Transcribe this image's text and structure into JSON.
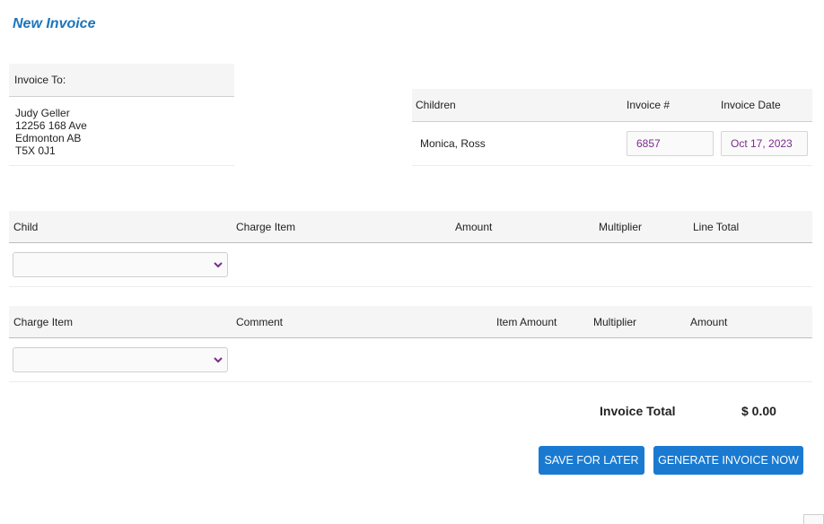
{
  "page": {
    "title": "New Invoice"
  },
  "invoice_to": {
    "label": "Invoice To:",
    "name": "Judy Geller",
    "street": "12256 168 Ave",
    "city": "Edmonton AB",
    "postal": "T5X 0J1"
  },
  "meta": {
    "children_label": "Children",
    "invoice_num_label": "Invoice #",
    "invoice_date_label": "Invoice Date",
    "children_value": "Monica, Ross",
    "invoice_num_value": "6857",
    "invoice_date_value": "Oct 17, 2023"
  },
  "child_charges": {
    "headers": [
      "Child",
      "Charge Item",
      "Amount",
      "Multiplier",
      "Line Total"
    ],
    "child_select_value": ""
  },
  "extra_charges": {
    "headers": [
      "Charge Item",
      "Comment",
      "Item Amount",
      "Multiplier",
      "Amount"
    ],
    "charge_select_value": ""
  },
  "totals": {
    "label": "Invoice Total",
    "value": "$ 0.00"
  },
  "buttons": {
    "save": "SAVE FOR LATER",
    "generate": "GENERATE INVOICE NOW"
  },
  "colors": {
    "accent": "#1a7ad1",
    "title": "#1b75bc",
    "field_text": "#7a2c8c"
  }
}
